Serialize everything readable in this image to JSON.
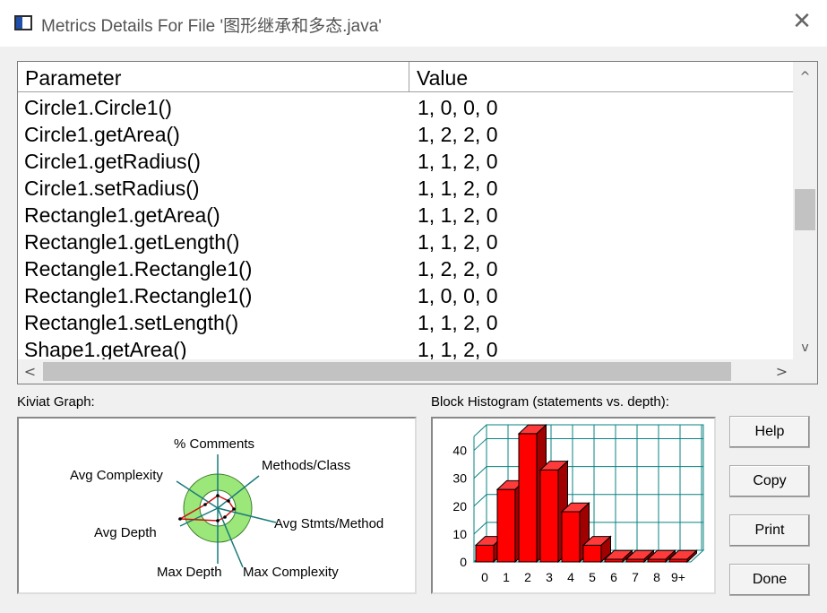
{
  "window": {
    "title": "Metrics Details For File '图形继承和多态.java'",
    "app_icon": "window-app-icon",
    "close_glyph": "✕"
  },
  "table": {
    "headers": [
      "Parameter",
      "Value"
    ],
    "rows": [
      {
        "parameter": "Circle1.Circle1()",
        "value": "1, 0, 0, 0"
      },
      {
        "parameter": "Circle1.getArea()",
        "value": "1, 2, 2, 0"
      },
      {
        "parameter": "Circle1.getRadius()",
        "value": "1, 1, 2, 0"
      },
      {
        "parameter": "Circle1.setRadius()",
        "value": "1, 1, 2, 0"
      },
      {
        "parameter": "Rectangle1.getArea()",
        "value": "1, 1, 2, 0"
      },
      {
        "parameter": "Rectangle1.getLength()",
        "value": "1, 1, 2, 0"
      },
      {
        "parameter": "Rectangle1.Rectangle1()",
        "value": "1, 2, 2, 0"
      },
      {
        "parameter": "Rectangle1.Rectangle1()",
        "value": "1, 0, 0, 0"
      },
      {
        "parameter": "Rectangle1.setLength()",
        "value": "1, 1, 2, 0"
      },
      {
        "parameter": "Shape1.getArea()",
        "value": "1, 1, 2, 0"
      }
    ],
    "scroll_up_glyph": "^",
    "scroll_down_glyph": "v",
    "scroll_left_glyph": "<",
    "scroll_right_glyph": ">"
  },
  "kiviat": {
    "label": "Kiviat Graph:",
    "axes": [
      "% Comments",
      "Methods/Class",
      "Avg Stmts/Method",
      "Max Complexity",
      "Max Depth",
      "Avg Depth",
      "Avg Complexity"
    ],
    "colors": {
      "ring": "#9be77a",
      "ring_outline": "#3a7a2a",
      "spoke": "#1a7a7a",
      "polygon": "#cc1111"
    }
  },
  "histogram": {
    "label": "Block Histogram (statements vs. depth):",
    "colors": {
      "bar": "#ff0000",
      "bar_top": "#ff3a3a",
      "bar_side": "#a00000",
      "grid": "#0a8080"
    }
  },
  "chart_data": {
    "type": "bar",
    "title": "Block Histogram (statements vs. depth):",
    "categories": [
      "0",
      "1",
      "2",
      "3",
      "4",
      "5",
      "6",
      "7",
      "8",
      "9+"
    ],
    "values": [
      6,
      26,
      46,
      33,
      18,
      6,
      0,
      0,
      0,
      0
    ],
    "ylim": [
      0,
      45
    ],
    "yticks": [
      0,
      10,
      20,
      30,
      40
    ],
    "grid": true
  },
  "buttons": {
    "help": "Help",
    "copy": "Copy",
    "print": "Print",
    "done": "Done"
  }
}
